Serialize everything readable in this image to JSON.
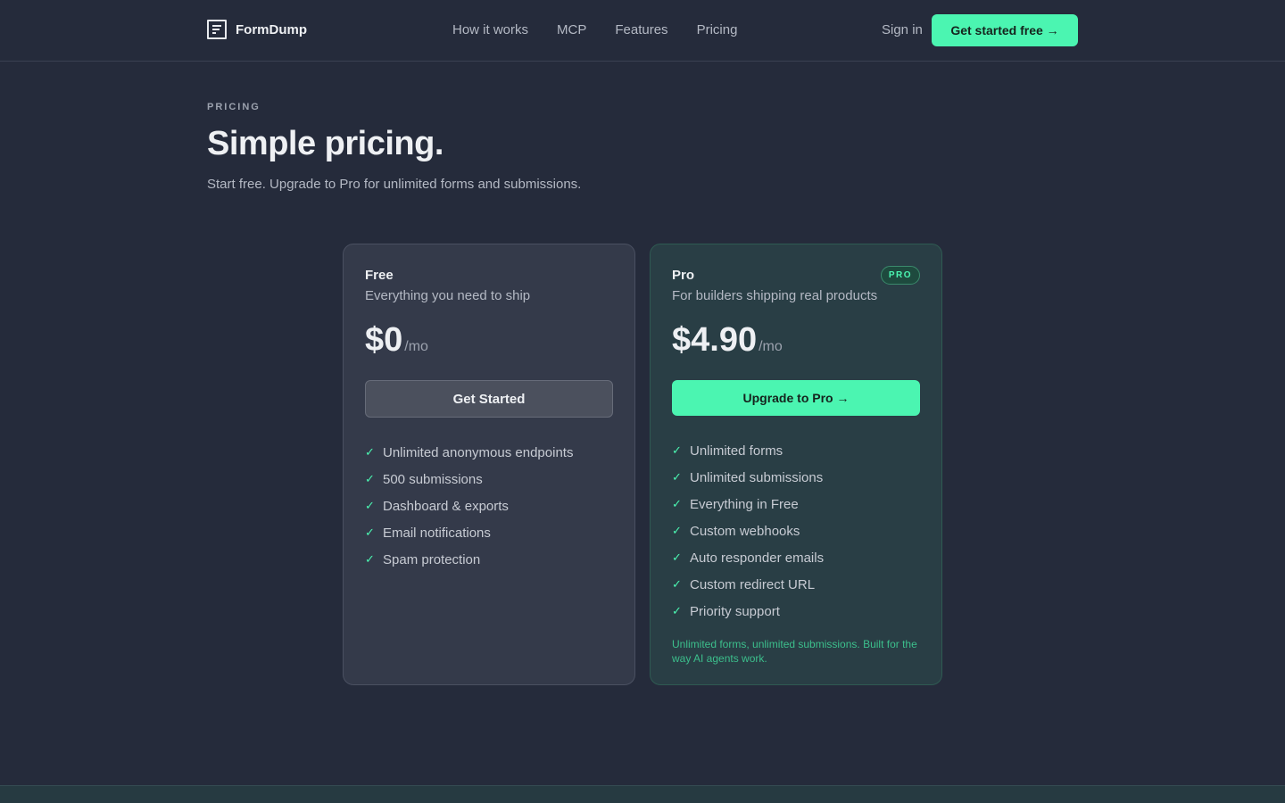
{
  "header": {
    "logo_name": "FormDump",
    "nav": [
      "How it works",
      "MCP",
      "Features",
      "Pricing"
    ],
    "signin": "Sign in",
    "cta": "Get started free →"
  },
  "hero": {
    "eyebrow": "PRICING",
    "title": "Simple pricing.",
    "subtitle": "Start free. Upgrade to Pro for unlimited forms and submissions."
  },
  "plans": {
    "free": {
      "name": "Free",
      "description": "Everything you need to ship",
      "price": "$0",
      "period": "/mo",
      "button": "Get Started",
      "features": [
        "Unlimited anonymous endpoints",
        "500 submissions",
        "Dashboard & exports",
        "Email notifications",
        "Spam protection"
      ]
    },
    "pro": {
      "name": "Pro",
      "badge": "PRO",
      "description": "For builders shipping real products",
      "price": "$4.90",
      "period": "/mo",
      "button": "Upgrade to Pro →",
      "features": [
        "Unlimited forms",
        "Unlimited submissions",
        "Everything in Free",
        "Custom webhooks",
        "Auto responder emails",
        "Custom redirect URL",
        "Priority support"
      ],
      "note": "Unlimited forms, unlimited submissions. Built for the way AI agents work."
    }
  },
  "colors": {
    "background": "#252b3b",
    "accent": "#4bf5b1",
    "free_card": "#343a4a",
    "pro_card": "#293e45"
  },
  "icons": {
    "logo": "form-document-icon",
    "feature": "check-icon"
  }
}
